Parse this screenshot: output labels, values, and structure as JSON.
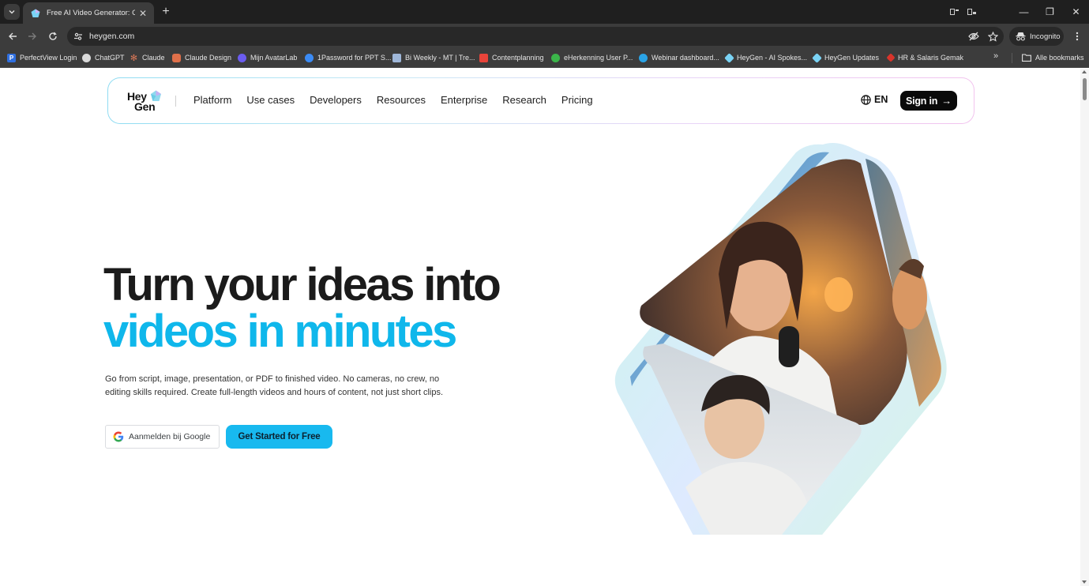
{
  "browser": {
    "tab": {
      "title": "Free AI Video Generator: Create",
      "close": "✕"
    },
    "new_tab": "+",
    "window": {
      "minimize": "—",
      "restore": "❐",
      "close": "✕"
    },
    "url": "heygen.com",
    "incognito_label": "Incognito",
    "bookmarks": [
      {
        "label": "PerfectView Login",
        "icon": "perfectview-icon",
        "color": "#2f6fe0"
      },
      {
        "label": "ChatGPT",
        "icon": "chatgpt-icon",
        "color": "#d9d9d9"
      },
      {
        "label": "Claude",
        "icon": "claude-icon",
        "color": "#d97757"
      },
      {
        "label": "Claude Design",
        "icon": "claude-design-icon",
        "color": "#e0704a"
      },
      {
        "label": "Mijn AvatarLab",
        "icon": "avatarlab-icon",
        "color": "#6b5cf0"
      },
      {
        "label": "1Password for PPT S...",
        "icon": "onepassword-icon",
        "color": "#3b8bf5"
      },
      {
        "label": "Bi Weekly - MT | Tre...",
        "icon": "trello-icon",
        "color": "#9fb7d9"
      },
      {
        "label": "Contentplanning",
        "icon": "calendar-icon",
        "color": "#e8443a"
      },
      {
        "label": "eHerkenning User P...",
        "icon": "eherkenning-icon",
        "color": "#3bb54a"
      },
      {
        "label": "Webinar dashboard...",
        "icon": "webinar-icon",
        "color": "#2aa3e6"
      },
      {
        "label": "HeyGen - AI Spokes...",
        "icon": "heygen-icon",
        "color": "#7ad3f5"
      },
      {
        "label": "HeyGen Updates",
        "icon": "heygen-icon",
        "color": "#7ad3f5"
      },
      {
        "label": "HR & Salaris Gemak",
        "icon": "hr-icon",
        "color": "#d9342b"
      }
    ],
    "bookmarks_more": "»",
    "all_bookmarks": "Alle bookmarks"
  },
  "page": {
    "logo": {
      "line1": "Hey",
      "line2": "Gen"
    },
    "nav": [
      "Platform",
      "Use cases",
      "Developers",
      "Resources",
      "Enterprise",
      "Research",
      "Pricing"
    ],
    "language": "EN",
    "sign_in": "Sign in",
    "sign_in_arrow": "→",
    "hero": {
      "line1": "Turn your ideas into",
      "line2": "videos in minutes",
      "subtitle": "Go from script, image, presentation, or PDF to finished video. No cameras, no crew, no editing skills required. Create full-length videos and hours of content, not just short clips."
    },
    "google_button": "Aanmelden bij Google",
    "cta_button": "Get Started for Free"
  },
  "colors": {
    "accent": "#18b9ef",
    "headline_blue": "#0fb7eb",
    "dark": "#0a0a0a"
  }
}
